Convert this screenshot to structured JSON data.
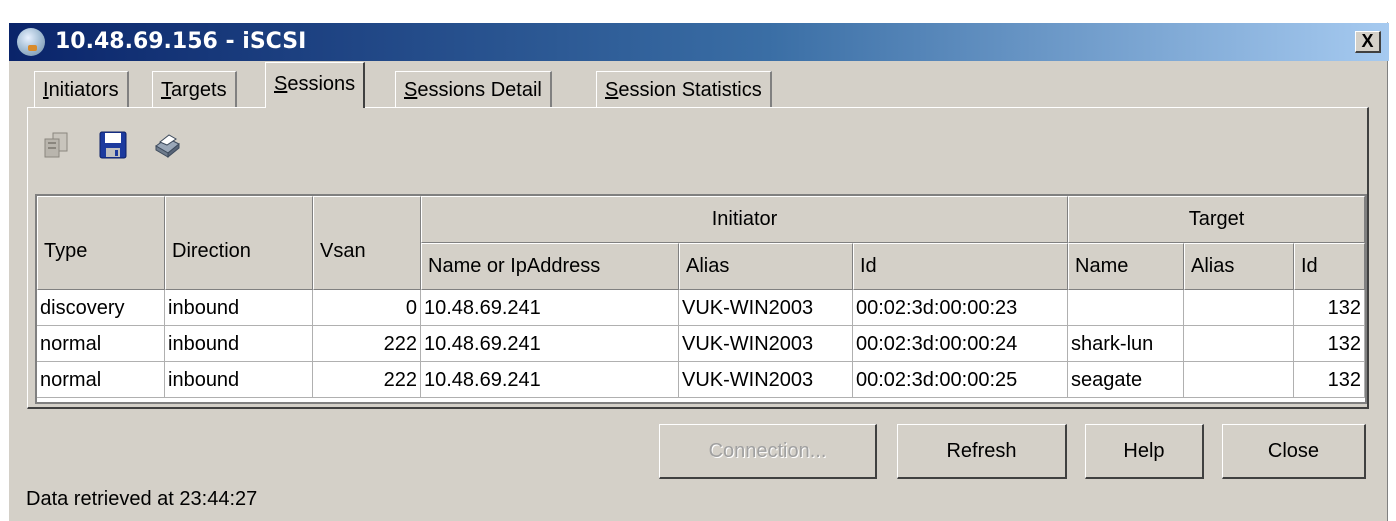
{
  "window": {
    "title": "10.48.69.156 - iSCSI",
    "close_label": "X"
  },
  "tabs": [
    {
      "label": "Initiators",
      "key": "I",
      "rest": "nitiators",
      "active": false
    },
    {
      "label": "Targets",
      "key": "T",
      "rest": "argets",
      "active": false
    },
    {
      "label": "Sessions",
      "key": "S",
      "rest": "essions",
      "active": true
    },
    {
      "label": "Sessions Detail",
      "key": "S",
      "rest": "essions Detail",
      "active": false
    },
    {
      "label": "Session Statistics",
      "key": "S",
      "rest": "ession Statistics",
      "active": false
    }
  ],
  "toolbar": {
    "icons": [
      "copy-icon",
      "save-icon",
      "print-icon"
    ]
  },
  "table": {
    "groups": {
      "initiator": "Initiator",
      "target": "Target"
    },
    "headers": {
      "type": "Type",
      "direction": "Direction",
      "vsan": "Vsan",
      "init_name": "Name or IpAddress",
      "init_alias": "Alias",
      "init_id": "Id",
      "tgt_name": "Name",
      "tgt_alias": "Alias",
      "tgt_id": "Id"
    },
    "rows": [
      {
        "type": "discovery",
        "direction": "inbound",
        "vsan": "0",
        "init_name": "10.48.69.241",
        "init_alias": "VUK-WIN2003",
        "init_id": "00:02:3d:00:00:23",
        "tgt_name": "",
        "tgt_alias": "",
        "tgt_id": "132"
      },
      {
        "type": "normal",
        "direction": "inbound",
        "vsan": "222",
        "init_name": "10.48.69.241",
        "init_alias": "VUK-WIN2003",
        "init_id": "00:02:3d:00:00:24",
        "tgt_name": "shark-lun",
        "tgt_alias": "",
        "tgt_id": "132"
      },
      {
        "type": "normal",
        "direction": "inbound",
        "vsan": "222",
        "init_name": "10.48.69.241",
        "init_alias": "VUK-WIN2003",
        "init_id": "00:02:3d:00:00:25",
        "tgt_name": "seagate",
        "tgt_alias": "",
        "tgt_id": "132"
      }
    ]
  },
  "buttons": {
    "connection": "Connection...",
    "refresh": "Refresh",
    "help": "Help",
    "close": "Close"
  },
  "status": "Data retrieved at 23:44:27"
}
